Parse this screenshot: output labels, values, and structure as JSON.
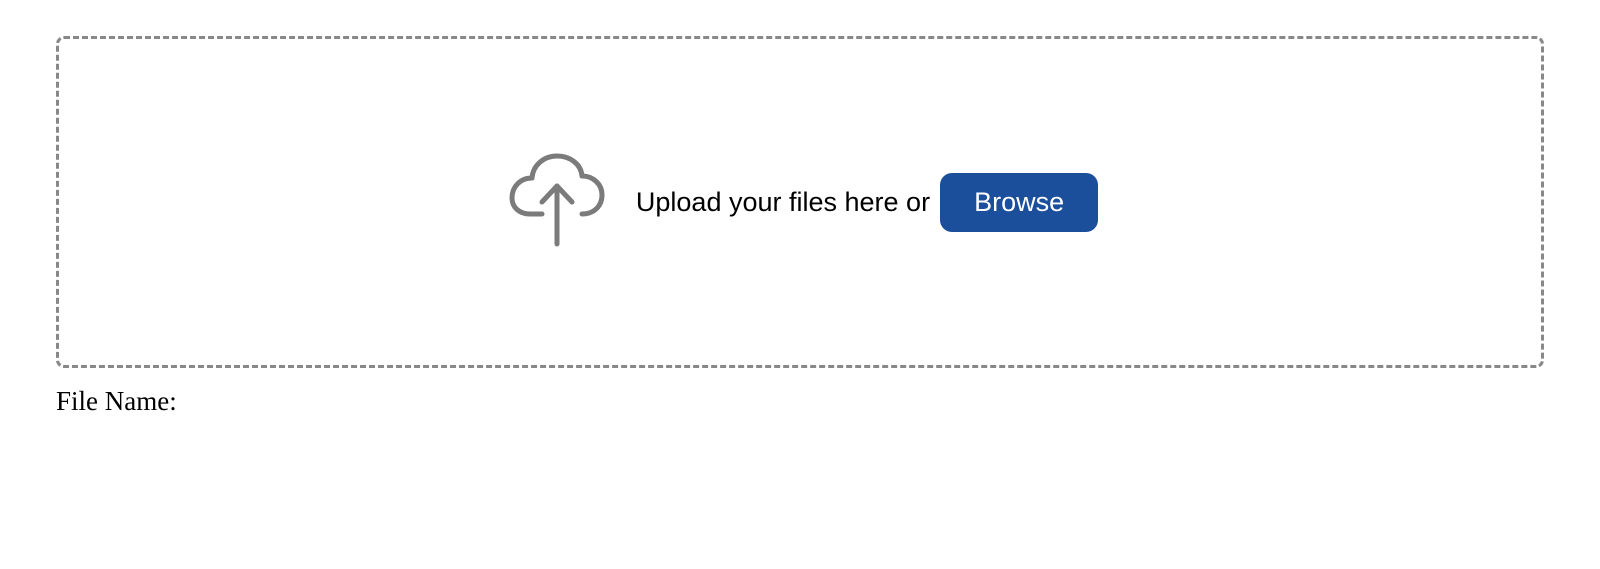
{
  "dropzone": {
    "prompt_text": "Upload your files here or",
    "browse_button_label": "Browse"
  },
  "file_section": {
    "label": "File Name:"
  },
  "colors": {
    "browse_button_bg": "#1b4f9c",
    "border_dash": "#888888",
    "icon_stroke": "#7b7b7b"
  }
}
